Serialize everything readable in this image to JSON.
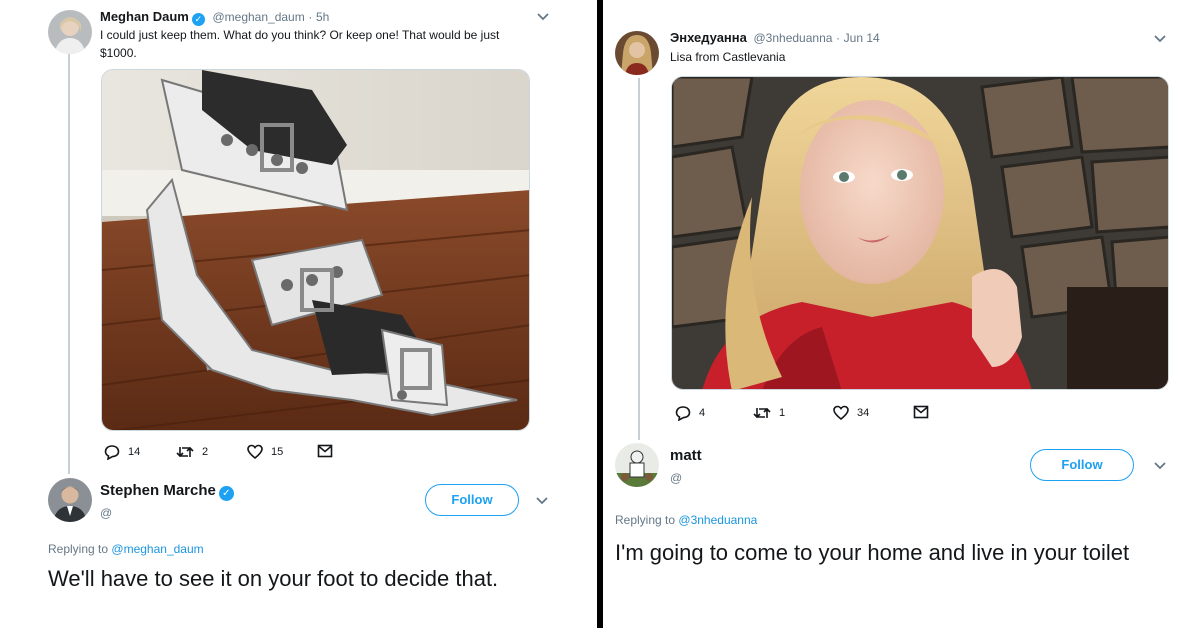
{
  "left": {
    "tweet": {
      "author_name": "Meghan Daum",
      "author_handle": "@meghan_daum",
      "time": "5h",
      "text": "I could just keep them. What do you think? Or keep one! That would be just $1000.",
      "replies": "14",
      "retweets": "2",
      "likes": "15"
    },
    "reply": {
      "author_name": "Stephen Marche",
      "author_handle": "@",
      "follow_label": "Follow",
      "replying_prefix": "Replying to",
      "replying_to": "@meghan_daum",
      "text": "We'll have to see it on your foot to decide that."
    }
  },
  "right": {
    "tweet": {
      "author_name": "Энхедуанна",
      "author_handle": "@3nheduanna",
      "time": "Jun 14",
      "text": "Lisa from Castlevania",
      "replies": "4",
      "retweets": "1",
      "likes": "34"
    },
    "reply": {
      "author_name": "matt",
      "author_handle": "@",
      "follow_label": "Follow",
      "replying_prefix": "Replying to",
      "replying_to": "@3nheduanna",
      "text": "I'm going to come to your home and live in your toilet"
    }
  },
  "colors": {
    "accent": "#1da1f2",
    "link": "#1b95e0",
    "muted": "#657786",
    "text": "#14171a",
    "thread_line": "#c4cfd6",
    "divider": "#000000"
  },
  "icons": [
    "reply-icon",
    "retweet-icon",
    "like-icon",
    "direct-message-icon",
    "chevron-down-icon",
    "verified-badge-icon"
  ]
}
